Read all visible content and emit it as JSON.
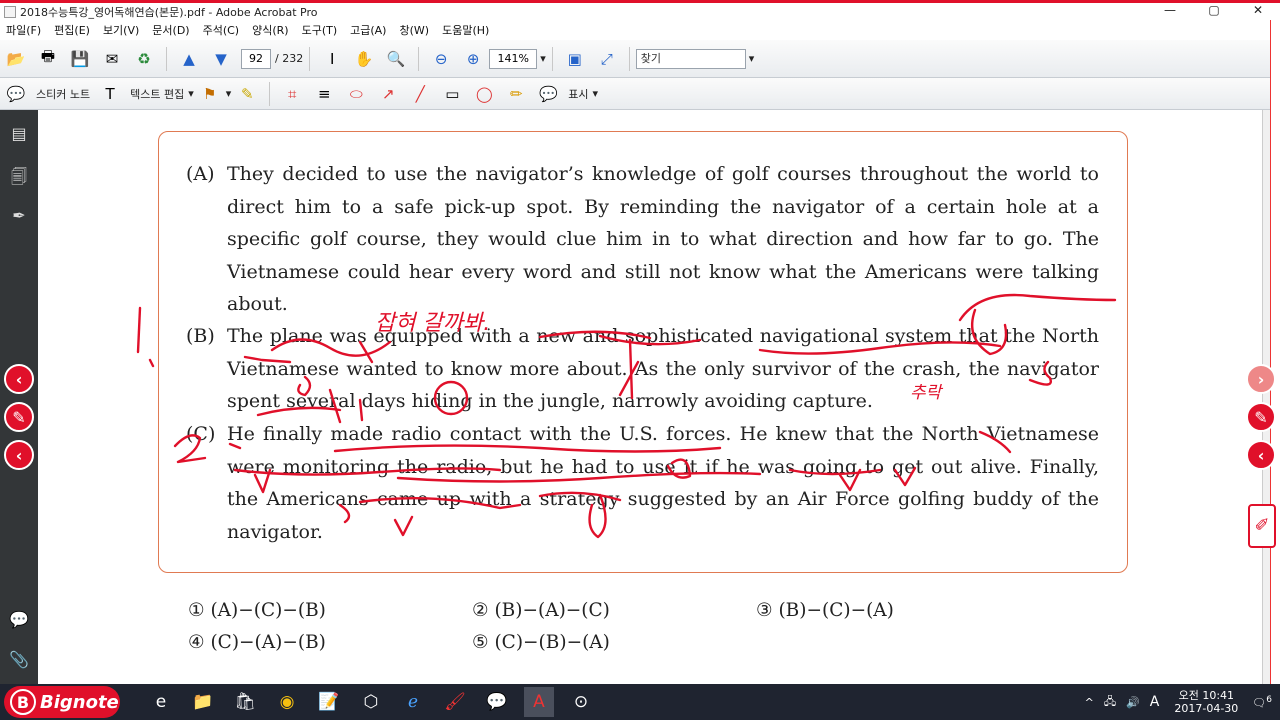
{
  "window": {
    "title": "2018수능특강_영어독해연습(본문).pdf - Adobe Acrobat Pro",
    "minimize": "—",
    "maximize": "▢",
    "close": "✕"
  },
  "menu": [
    "파일(F)",
    "편집(E)",
    "보기(V)",
    "문서(D)",
    "주석(C)",
    "양식(R)",
    "도구(T)",
    "고급(A)",
    "창(W)",
    "도움말(H)"
  ],
  "toolbar": {
    "current_page": "92",
    "page_separator": "/ 232",
    "zoom": "141%",
    "find_placeholder": "찾기"
  },
  "comment_toolbar": {
    "sticky_note": "스티커 노트",
    "text_edit": "텍스트 편집",
    "show": "표시"
  },
  "document": {
    "paragraphs": [
      {
        "tag": "(A)",
        "text": "They decided to use the navigator’s knowledge of golf courses throughout the world to direct him to a safe pick-up spot. By reminding the navigator of a certain hole at a specific golf course, they would clue him in to what direction and how far to go. The Vietnamese could hear every word and still not know what the Americans were talking about."
      },
      {
        "tag": "(B)",
        "text": "The plane was equipped with a new and sophisticated navigational system that the North Vietnamese wanted to know more about. As the only survivor of the crash, the navigator spent several days hiding in the jungle, narrowly avoiding capture."
      },
      {
        "tag": "(C)",
        "text": "He finally made radio contact with the U.S. forces. He knew that the North Vietnamese were monitoring the radio, but he had to use it if he was going to get out alive. Finally, the Americans came up with a strategy suggested by an Air Force golfing buddy of the navigator."
      }
    ],
    "options": [
      "① (A)−(C)−(B)",
      "② (B)−(A)−(C)",
      "③ (B)−(C)−(A)",
      "④ (C)−(A)−(B)",
      "⑤ (C)−(B)−(A)"
    ]
  },
  "annotations": {
    "handwritten_1": "잡혀 갈까봐.",
    "handwritten_2": "추락"
  },
  "taskbar": {
    "brand": "Bignote",
    "clock_ampm": "오전 10:41",
    "clock_date": "2017-04-30",
    "ime": "A",
    "notif_count": "6"
  },
  "colors": {
    "accent_red": "#e0102a",
    "card_border": "#e07a52",
    "ink_red": "#e0102a"
  }
}
